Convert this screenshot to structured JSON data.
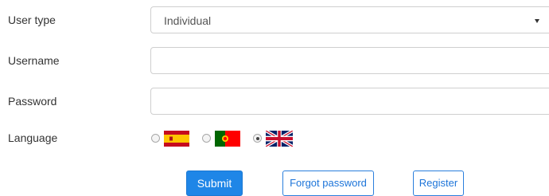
{
  "form": {
    "user_type_label": "User type",
    "user_type_value": "Individual",
    "username_label": "Username",
    "username_value": "",
    "password_label": "Password",
    "password_value": "",
    "language_label": "Language",
    "languages": [
      {
        "code": "es",
        "flag": "spain-flag-icon",
        "selected": false
      },
      {
        "code": "pt",
        "flag": "portugal-flag-icon",
        "selected": false
      },
      {
        "code": "en",
        "flag": "uk-flag-icon",
        "selected": true
      }
    ]
  },
  "buttons": {
    "submit_label": "Submit",
    "forgot_label": "Forgot password",
    "register_label": "Register"
  },
  "colors": {
    "primary": "#1f86e7",
    "outline": "#2a7fdd"
  }
}
